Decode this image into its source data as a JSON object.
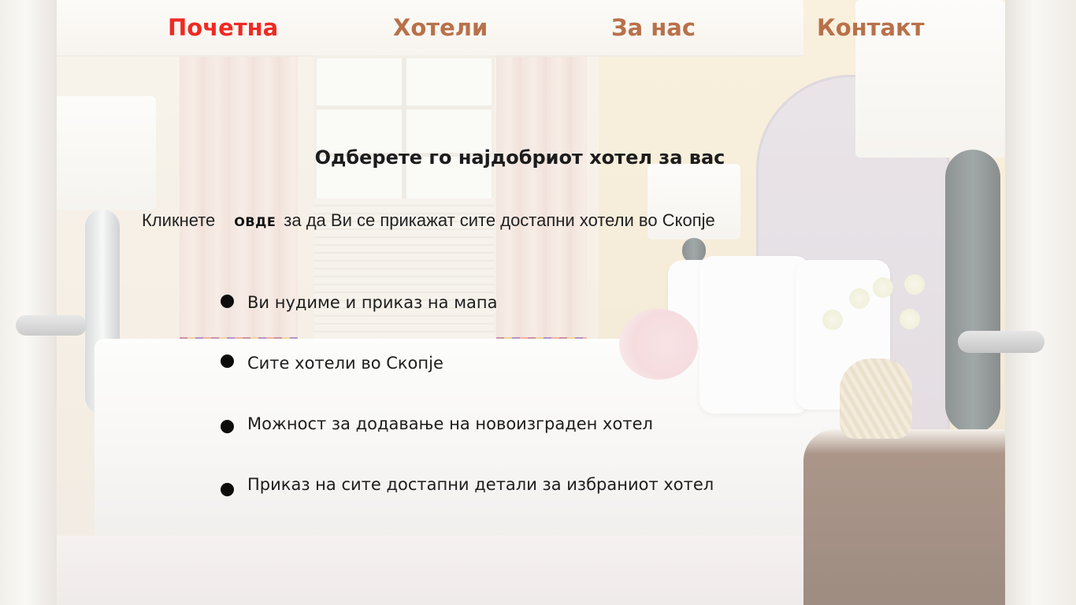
{
  "nav": {
    "items": [
      {
        "label": "Почетна",
        "active": true
      },
      {
        "label": "Хотели",
        "active": false
      },
      {
        "label": "За нас",
        "active": false
      },
      {
        "label": "Контакт",
        "active": false
      }
    ],
    "active_color": "#ef2a22",
    "link_color": "#b8714a"
  },
  "main": {
    "headline": "Одберете го најдобриот хотел за вас",
    "intro": {
      "before": "Кликнете",
      "link_label": "ОВДЕ",
      "after": "за да Ви се прикажат сите достапни хотели во Скопје"
    },
    "features": [
      "Ви нудиме и приказ на мапа",
      "Сите хотели во Скопје",
      "Можност за додавање на новоизграден хотел",
      "Приказ на сите достапни детали за избраниот хотел"
    ]
  },
  "background": {
    "image_subject": "hotel-bedroom"
  }
}
